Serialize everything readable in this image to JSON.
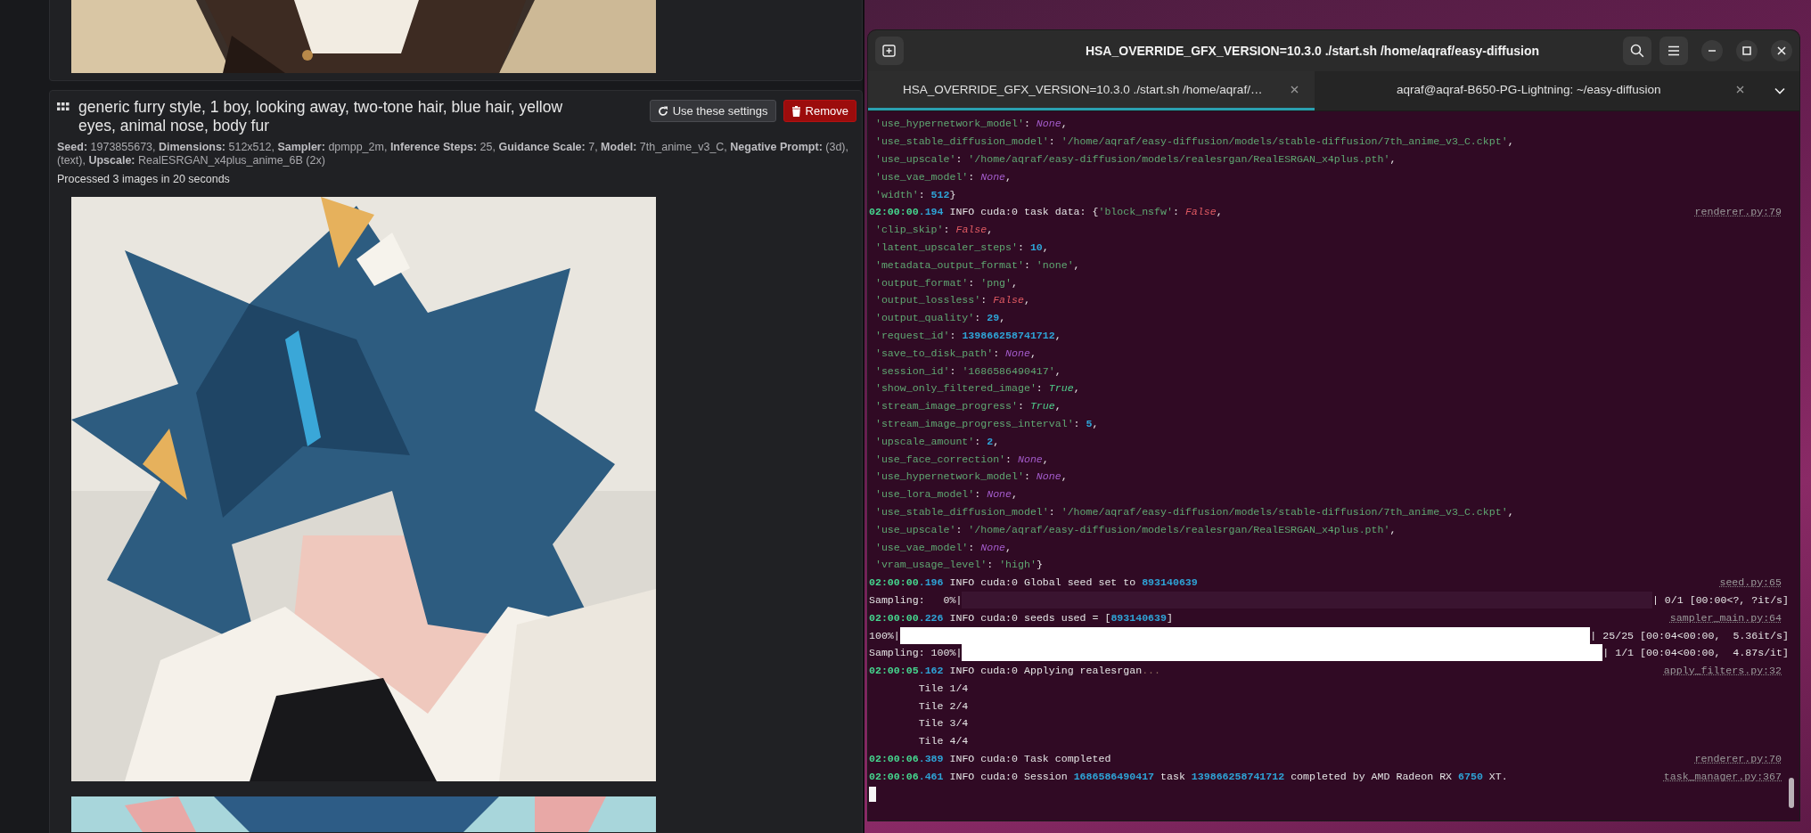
{
  "results": [
    {
      "images": [
        {
          "kind": "picture"
        }
      ]
    },
    {
      "prompt": "generic furry style, 1 boy, looking away, two-tone hair, blue hair, yellow eyes, animal nose, body fur",
      "buttons": [
        {
          "label": "Use these settings",
          "kind": "reuse"
        },
        {
          "label": "Remove",
          "kind": "remove"
        }
      ],
      "settings": "**Seed:** 1973855673, **Dimensions:** 512x512, **Sampler:** dpmpp_2m, **Inference Steps:** 25, **Guidance Scale:** 7, **Model:** 7th_anime_v3_C, **Negative Prompt:** (3d), (text), **Upscale:** RealESRGAN_x4plus_anime_6B (2x)",
      "status": "Processed 3 images in 20 seconds",
      "images": [
        {
          "kind": "picture"
        },
        {
          "kind": "picture"
        }
      ]
    }
  ],
  "terminal": {
    "title": "HSA_OVERRIDE_GFX_VERSION=10.3.0 ./start.sh /home/aqraf/easy-diffusion",
    "tabs": [
      {
        "label": "HSA_OVERRIDE_GFX_VERSION=10.3.0 ./start.sh /home/aqraf/…",
        "selected": true
      },
      {
        "label": "aqraf@aqraf-B650-PG-Lightning: ~/easy-diffusion",
        "selected": false
      }
    ],
    "lines": [
      {
        "segments": [
          {
            "kind": "str",
            "text": " 'use_hypernetwork_model'"
          },
          {
            "kind": "plain",
            "text": ": "
          },
          {
            "kind": "none",
            "text": "None"
          },
          {
            "kind": "plain",
            "text": ","
          }
        ]
      },
      {
        "segments": [
          {
            "kind": "str",
            "text": " 'use_stable_diffusion_model'"
          },
          {
            "kind": "plain",
            "text": ": "
          },
          {
            "kind": "str",
            "text": "'/home/aqraf/easy-diffusion/models/stable-diffusion/7th_anime_v3_C.ckpt'"
          },
          {
            "kind": "plain",
            "text": ","
          }
        ]
      },
      {
        "segments": [
          {
            "kind": "str",
            "text": " 'use_upscale'"
          },
          {
            "kind": "plain",
            "text": ": "
          },
          {
            "kind": "str",
            "text": "'/home/aqraf/easy-diffusion/models/realesrgan/RealESRGAN_x4plus.pth'"
          },
          {
            "kind": "plain",
            "text": ","
          }
        ]
      },
      {
        "segments": [
          {
            "kind": "str",
            "text": " 'use_vae_model'"
          },
          {
            "kind": "plain",
            "text": ": "
          },
          {
            "kind": "none",
            "text": "None"
          },
          {
            "kind": "plain",
            "text": ","
          }
        ]
      },
      {
        "segments": [
          {
            "kind": "str",
            "text": " 'width'"
          },
          {
            "kind": "plain",
            "text": ": "
          },
          {
            "kind": "num",
            "text": "512"
          },
          {
            "kind": "plain",
            "text": "}"
          }
        ]
      },
      {
        "segments": [
          {
            "kind": "time",
            "text": "02:00:00"
          },
          {
            "kind": "num",
            "text": ".194"
          },
          {
            "kind": "plain",
            "text": " INFO cuda:0 task data: {"
          },
          {
            "kind": "str",
            "text": "'block_nsfw'"
          },
          {
            "kind": "plain",
            "text": ": "
          },
          {
            "kind": "false",
            "text": "False"
          },
          {
            "kind": "plain",
            "text": ","
          }
        ],
        "source": "renderer.py:79"
      },
      {
        "segments": [
          {
            "kind": "str",
            "text": " 'clip_skip'"
          },
          {
            "kind": "plain",
            "text": ": "
          },
          {
            "kind": "false",
            "text": "False"
          },
          {
            "kind": "plain",
            "text": ","
          }
        ]
      },
      {
        "segments": [
          {
            "kind": "str",
            "text": " 'latent_upscaler_steps'"
          },
          {
            "kind": "plain",
            "text": ": "
          },
          {
            "kind": "num",
            "text": "10"
          },
          {
            "kind": "plain",
            "text": ","
          }
        ]
      },
      {
        "segments": [
          {
            "kind": "str",
            "text": " 'metadata_output_format'"
          },
          {
            "kind": "plain",
            "text": ": "
          },
          {
            "kind": "str",
            "text": "'none'"
          },
          {
            "kind": "plain",
            "text": ","
          }
        ]
      },
      {
        "segments": [
          {
            "kind": "str",
            "text": " 'output_format'"
          },
          {
            "kind": "plain",
            "text": ": "
          },
          {
            "kind": "str",
            "text": "'png'"
          },
          {
            "kind": "plain",
            "text": ","
          }
        ]
      },
      {
        "segments": [
          {
            "kind": "str",
            "text": " 'output_lossless'"
          },
          {
            "kind": "plain",
            "text": ": "
          },
          {
            "kind": "false",
            "text": "False"
          },
          {
            "kind": "plain",
            "text": ","
          }
        ]
      },
      {
        "segments": [
          {
            "kind": "str",
            "text": " 'output_quality'"
          },
          {
            "kind": "plain",
            "text": ": "
          },
          {
            "kind": "num",
            "text": "29"
          },
          {
            "kind": "plain",
            "text": ","
          }
        ]
      },
      {
        "segments": [
          {
            "kind": "str",
            "text": " 'request_id'"
          },
          {
            "kind": "plain",
            "text": ": "
          },
          {
            "kind": "num",
            "text": "139866258741712"
          },
          {
            "kind": "plain",
            "text": ","
          }
        ]
      },
      {
        "segments": [
          {
            "kind": "str",
            "text": " 'save_to_disk_path'"
          },
          {
            "kind": "plain",
            "text": ": "
          },
          {
            "kind": "none",
            "text": "None"
          },
          {
            "kind": "plain",
            "text": ","
          }
        ]
      },
      {
        "segments": [
          {
            "kind": "str",
            "text": " 'session_id'"
          },
          {
            "kind": "plain",
            "text": ": "
          },
          {
            "kind": "str",
            "text": "'1686586490417'"
          },
          {
            "kind": "plain",
            "text": ","
          }
        ]
      },
      {
        "segments": [
          {
            "kind": "str",
            "text": " 'show_only_filtered_image'"
          },
          {
            "kind": "plain",
            "text": ": "
          },
          {
            "kind": "true",
            "text": "True"
          },
          {
            "kind": "plain",
            "text": ","
          }
        ]
      },
      {
        "segments": [
          {
            "kind": "str",
            "text": " 'stream_image_progress'"
          },
          {
            "kind": "plain",
            "text": ": "
          },
          {
            "kind": "true",
            "text": "True"
          },
          {
            "kind": "plain",
            "text": ","
          }
        ]
      },
      {
        "segments": [
          {
            "kind": "str",
            "text": " 'stream_image_progress_interval'"
          },
          {
            "kind": "plain",
            "text": ": "
          },
          {
            "kind": "num",
            "text": "5"
          },
          {
            "kind": "plain",
            "text": ","
          }
        ]
      },
      {
        "segments": [
          {
            "kind": "str",
            "text": " 'upscale_amount'"
          },
          {
            "kind": "plain",
            "text": ": "
          },
          {
            "kind": "num",
            "text": "2"
          },
          {
            "kind": "plain",
            "text": ","
          }
        ]
      },
      {
        "segments": [
          {
            "kind": "str",
            "text": " 'use_face_correction'"
          },
          {
            "kind": "plain",
            "text": ": "
          },
          {
            "kind": "none",
            "text": "None"
          },
          {
            "kind": "plain",
            "text": ","
          }
        ]
      },
      {
        "segments": [
          {
            "kind": "str",
            "text": " 'use_hypernetwork_model'"
          },
          {
            "kind": "plain",
            "text": ": "
          },
          {
            "kind": "none",
            "text": "None"
          },
          {
            "kind": "plain",
            "text": ","
          }
        ]
      },
      {
        "segments": [
          {
            "kind": "str",
            "text": " 'use_lora_model'"
          },
          {
            "kind": "plain",
            "text": ": "
          },
          {
            "kind": "none",
            "text": "None"
          },
          {
            "kind": "plain",
            "text": ","
          }
        ]
      },
      {
        "segments": [
          {
            "kind": "str",
            "text": " 'use_stable_diffusion_model'"
          },
          {
            "kind": "plain",
            "text": ": "
          },
          {
            "kind": "str",
            "text": "'/home/aqraf/easy-diffusion/models/stable-diffusion/7th_anime_v3_C.ckpt'"
          },
          {
            "kind": "plain",
            "text": ","
          }
        ]
      },
      {
        "segments": [
          {
            "kind": "str",
            "text": " 'use_upscale'"
          },
          {
            "kind": "plain",
            "text": ": "
          },
          {
            "kind": "str",
            "text": "'/home/aqraf/easy-diffusion/models/realesrgan/RealESRGAN_x4plus.pth'"
          },
          {
            "kind": "plain",
            "text": ","
          }
        ]
      },
      {
        "segments": [
          {
            "kind": "str",
            "text": " 'use_vae_model'"
          },
          {
            "kind": "plain",
            "text": ": "
          },
          {
            "kind": "none",
            "text": "None"
          },
          {
            "kind": "plain",
            "text": ","
          }
        ]
      },
      {
        "segments": [
          {
            "kind": "str",
            "text": " 'vram_usage_level'"
          },
          {
            "kind": "plain",
            "text": ": "
          },
          {
            "kind": "str",
            "text": "'high'"
          },
          {
            "kind": "plain",
            "text": "}"
          }
        ]
      },
      {
        "segments": [
          {
            "kind": "time",
            "text": "02:00:00"
          },
          {
            "kind": "num",
            "text": ".196"
          },
          {
            "kind": "plain",
            "text": " INFO cuda:0 Global seed set to "
          },
          {
            "kind": "num",
            "text": "893140639"
          }
        ],
        "source": "seed.py:65"
      },
      {
        "kind": "progress",
        "prefix": "Sampling:   0%|",
        "level": 0,
        "suffix": "| 0/1 [00:00<?, ?it/s]"
      },
      {
        "segments": [
          {
            "kind": "time",
            "text": "02:00:00"
          },
          {
            "kind": "num",
            "text": ".226"
          },
          {
            "kind": "plain",
            "text": " INFO cuda:0 seeds used = ["
          },
          {
            "kind": "num",
            "text": "893140639"
          },
          {
            "kind": "plain",
            "text": "]"
          }
        ],
        "source": "sampler_main.py:64"
      },
      {
        "kind": "progress",
        "prefix": "100%|",
        "level": 1,
        "suffix": "| 25/25 [00:04<00:00,  5.36it/s]"
      },
      {
        "kind": "progress",
        "prefix": "Sampling: 100%|",
        "level": 1,
        "suffix": "| 1/1 [00:04<00:00,  4.87s/it]"
      },
      {
        "segments": [
          {
            "kind": "time",
            "text": "02:00:05"
          },
          {
            "kind": "num",
            "text": ".162"
          },
          {
            "kind": "plain",
            "text": " INFO cuda:0 Applying realesrgan"
          },
          {
            "kind": "dim",
            "text": "..."
          }
        ],
        "source": "apply_filters.py:32"
      },
      {
        "segments": [
          {
            "kind": "plain",
            "text": "        Tile 1/4"
          }
        ]
      },
      {
        "segments": [
          {
            "kind": "plain",
            "text": "        Tile 2/4"
          }
        ]
      },
      {
        "segments": [
          {
            "kind": "plain",
            "text": "        Tile 3/4"
          }
        ]
      },
      {
        "segments": [
          {
            "kind": "plain",
            "text": "        Tile 4/4"
          }
        ]
      },
      {
        "segments": [
          {
            "kind": "time",
            "text": "02:00:06"
          },
          {
            "kind": "num",
            "text": ".389"
          },
          {
            "kind": "plain",
            "text": " INFO cuda:0 Task completed"
          }
        ],
        "source": "renderer.py:70"
      },
      {
        "segments": [
          {
            "kind": "time",
            "text": "02:00:06"
          },
          {
            "kind": "num",
            "text": ".461"
          },
          {
            "kind": "plain",
            "text": " INFO cuda:0 Session "
          },
          {
            "kind": "num",
            "text": "1686586490417"
          },
          {
            "kind": "plain",
            "text": " task "
          },
          {
            "kind": "num",
            "text": "139866258741712"
          },
          {
            "kind": "plain",
            "text": " completed by AMD Radeon RX "
          },
          {
            "kind": "num",
            "text": "6750"
          },
          {
            "kind": "plain",
            "text": " XT."
          }
        ],
        "source": "task_manager.py:367"
      }
    ]
  }
}
